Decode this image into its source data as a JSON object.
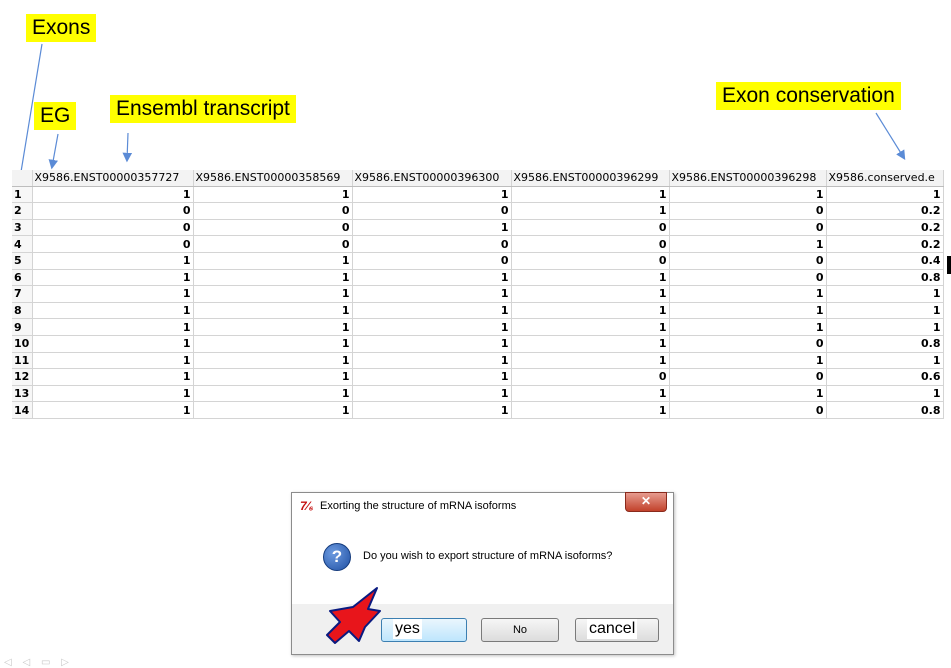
{
  "callouts": {
    "exons": "Exons",
    "eg": "EG",
    "ensembl": "Ensembl transcript",
    "conservation": "Exon conservation"
  },
  "colors": {
    "callout": "#ffff00",
    "arrow": "#5b8bd6",
    "red_arrow": "#e8151b"
  },
  "table": {
    "headers": [
      "",
      "X9586.ENST00000357727",
      "X9586.ENST00000358569",
      "X9586.ENST00000396300",
      "X9586.ENST00000396299",
      "X9586.ENST00000396298",
      "X9586.conserved.e"
    ],
    "rows": [
      [
        "1",
        "1",
        "1",
        "1",
        "1",
        "1",
        "1"
      ],
      [
        "2",
        "0",
        "0",
        "0",
        "1",
        "0",
        "0.2"
      ],
      [
        "3",
        "0",
        "0",
        "1",
        "0",
        "0",
        "0.2"
      ],
      [
        "4",
        "0",
        "0",
        "0",
        "0",
        "1",
        "0.2"
      ],
      [
        "5",
        "1",
        "1",
        "0",
        "0",
        "0",
        "0.4"
      ],
      [
        "6",
        "1",
        "1",
        "1",
        "1",
        "0",
        "0.8"
      ],
      [
        "7",
        "1",
        "1",
        "1",
        "1",
        "1",
        "1"
      ],
      [
        "8",
        "1",
        "1",
        "1",
        "1",
        "1",
        "1"
      ],
      [
        "9",
        "1",
        "1",
        "1",
        "1",
        "1",
        "1"
      ],
      [
        "10",
        "1",
        "1",
        "1",
        "1",
        "0",
        "0.8"
      ],
      [
        "11",
        "1",
        "1",
        "1",
        "1",
        "1",
        "1"
      ],
      [
        "12",
        "1",
        "1",
        "1",
        "0",
        "0",
        "0.6"
      ],
      [
        "13",
        "1",
        "1",
        "1",
        "1",
        "1",
        "1"
      ],
      [
        "14",
        "1",
        "1",
        "1",
        "1",
        "0",
        "0.8"
      ]
    ]
  },
  "dialog": {
    "app_icon": "7⁄₆",
    "title": "Exorting the structure of mRNA isoforms",
    "close": "✕",
    "icon": "?",
    "message": "Do you wish to export structure of mRNA isoforms?",
    "btn_yes": "",
    "btn_no": "No",
    "btn_cancel": "",
    "overlay_yes": "yes",
    "overlay_cancel": "cancel"
  },
  "slide_nav": "◁ ◁ ▭ ▷"
}
